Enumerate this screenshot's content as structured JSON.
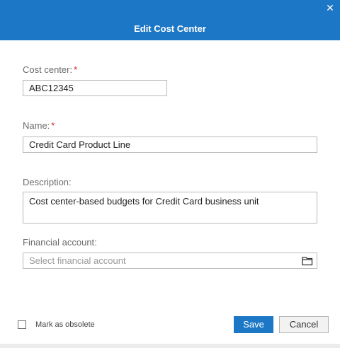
{
  "dialog": {
    "title": "Edit Cost Center",
    "close_glyph": "✕"
  },
  "form": {
    "cost_center": {
      "label": "Cost center:",
      "required_mark": "*",
      "value": "ABC12345"
    },
    "name": {
      "label": "Name:",
      "required_mark": "*",
      "value": "Credit Card Product Line"
    },
    "description": {
      "label": "Description:",
      "value": "Cost center-based budgets for Credit Card business unit"
    },
    "financial_account": {
      "label": "Financial account:",
      "value": "",
      "placeholder": "Select financial account",
      "browse_icon": "folder-icon"
    }
  },
  "footer": {
    "obsolete_label": "Mark as obsolete",
    "obsolete_checked": false,
    "save_label": "Save",
    "cancel_label": "Cancel"
  },
  "colors": {
    "accent": "#1c78c6",
    "required": "#d02828"
  }
}
